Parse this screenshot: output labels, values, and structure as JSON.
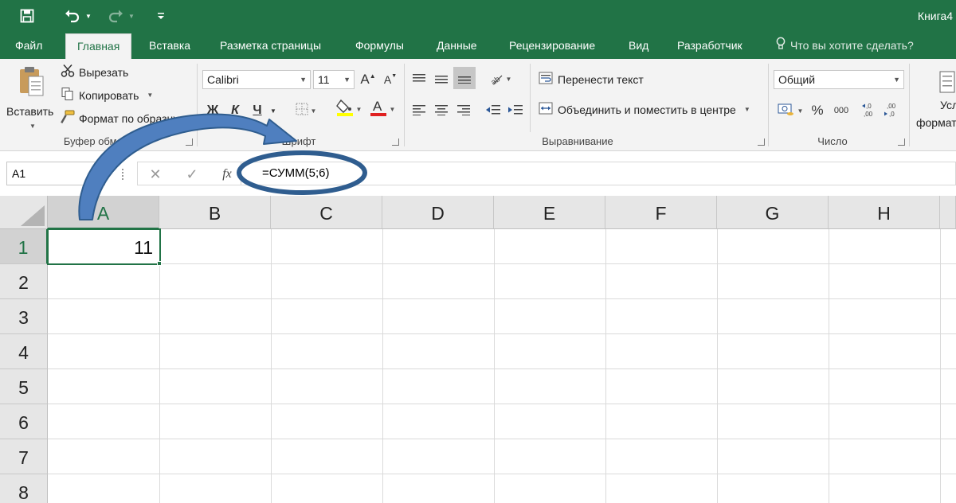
{
  "window": {
    "title": "Книга4"
  },
  "tabs": [
    "Файл",
    "Главная",
    "Вставка",
    "Разметка страницы",
    "Формулы",
    "Данные",
    "Рецензирование",
    "Вид",
    "Разработчик"
  ],
  "active_tab": "Главная",
  "tell_me": "Что вы хотите сделать?",
  "clipboard": {
    "paste": "Вставить",
    "cut": "Вырезать",
    "copy": "Копировать",
    "format_painter": "Формат по образцу",
    "group_label": "Буфер обмена"
  },
  "font": {
    "name": "Calibri",
    "size": "11",
    "bold": "Ж",
    "italic": "К",
    "underline": "Ч",
    "group_label": "Шрифт"
  },
  "alignment": {
    "wrap_text": "Перенести текст",
    "merge_center": "Объединить и поместить в центре",
    "group_label": "Выравнивание"
  },
  "number": {
    "format": "Общий",
    "percent": "%",
    "thousands": "000",
    "group_label": "Число"
  },
  "styles_partial": {
    "line1": "Усл",
    "line2": "формат"
  },
  "formula_bar": {
    "name_box": "A1",
    "fx": "fx",
    "formula": "=СУММ(5;6)"
  },
  "grid": {
    "columns": [
      "A",
      "B",
      "C",
      "D",
      "E",
      "F",
      "G",
      "H"
    ],
    "rows": [
      "1",
      "2",
      "3",
      "4",
      "5",
      "6",
      "7",
      "8"
    ],
    "active_cell": "A1",
    "active_cell_value": "11"
  },
  "colors": {
    "excel_green": "#217346",
    "annotation_blue": "#4f7fbf",
    "annotation_outline": "#2f5d8f"
  }
}
